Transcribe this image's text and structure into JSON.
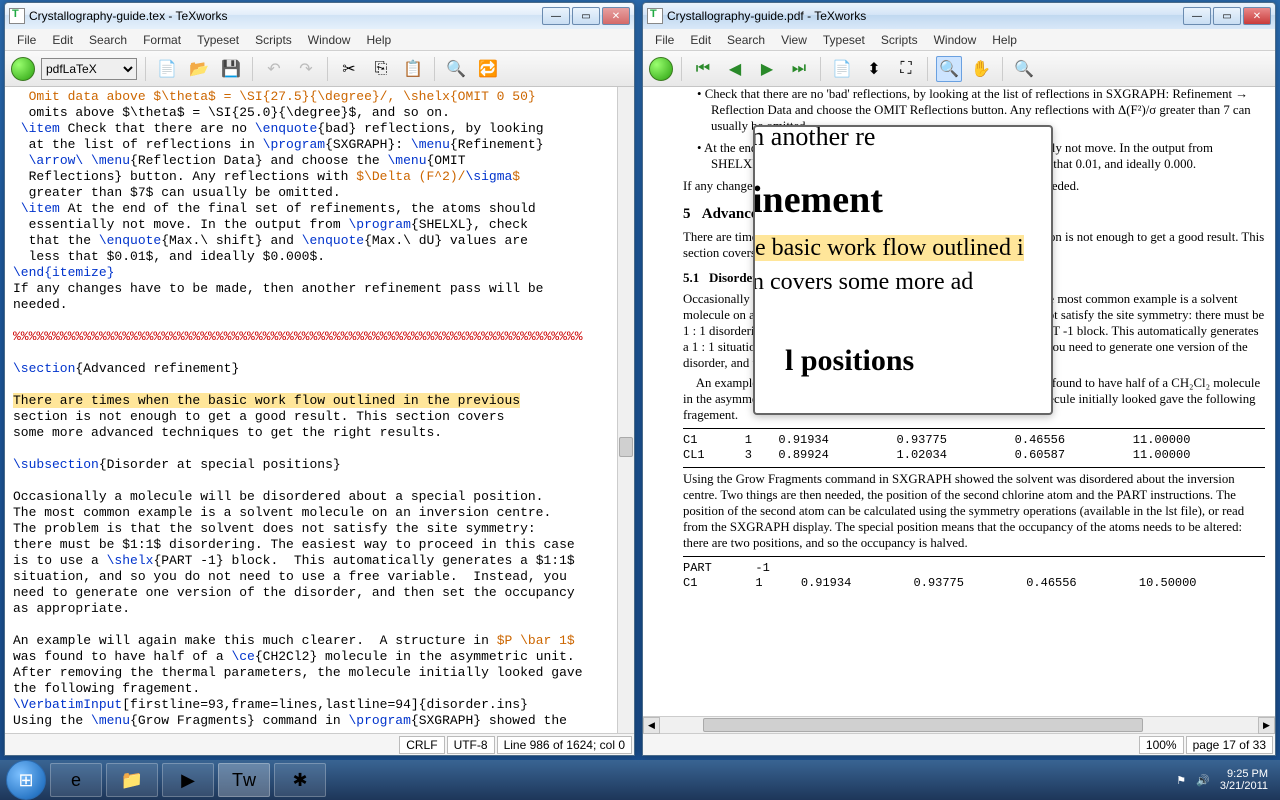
{
  "left_window": {
    "title": "Crystallography-guide.tex - TeXworks",
    "menu": [
      "File",
      "Edit",
      "Search",
      "Format",
      "Typeset",
      "Scripts",
      "Window",
      "Help"
    ],
    "engine": "pdfLaTeX",
    "status": {
      "crlf": "CRLF",
      "encoding": "UTF-8",
      "pos": "Line 986 of 1624; col 0"
    }
  },
  "right_window": {
    "title": "Crystallography-guide.pdf - TeXworks",
    "menu": [
      "File",
      "Edit",
      "Search",
      "View",
      "Typeset",
      "Scripts",
      "Window",
      "Help"
    ],
    "zoom": "100%",
    "page": "page 17 of 33",
    "content": {
      "bullet2_pre": "Check that there are no 'bad' reflections, by looking at the list of reflections in SXGRAPH: Refinement → Reflection Data and choose the OMIT Reflections button. Any reflections with Δ(F²)/σ greater than 7 can usually be omitted.",
      "bullet3": "At the end of the final set of refinements, the atoms should essentially not move. In the output from SHELXL, check that the 'Max. shift' and 'Max. dU' values are less that 0.01, and ideally 0.000.",
      "ifchanges": "If any changes have to be made, then another refinement pass will be needed.",
      "sec5_num": "5",
      "sec5_title": "Advanced refinement",
      "sec5_para": "There are times when the basic work flow outlined in the previous section is not enough to get a good result. This section covers some more advanced techniques to get the right results.",
      "sec51_num": "5.1",
      "sec51_title": "Disorder at special positions",
      "sec51_p1": "Occasionally a molecule will be disordered about a special position. The most common example is a solvent molecule on an inversion centre. The problem is that the solvent does not satisfy the site symmetry: there must be 1 : 1 disordering. The easiest way to proceed in this case is to use a PART -1 block. This automatically generates a 1 : 1 situation, and so you do not need to use a free variable. Instead, you need to generate one version of the disorder, and then set the occupancy as appropriate.",
      "sec51_p2": "    An example will again make this much clearer. A structure in P1̄ was found to have half of a CH₂Cl₂ molecule in the asymmetric unit. After removing the thermal parameters, the molecule initially looked gave the following fragement.",
      "table1": [
        [
          "C1",
          "1",
          "0.91934",
          "0.93775",
          "0.46556",
          "11.00000"
        ],
        [
          "CL1",
          "3",
          "0.89924",
          "1.02034",
          "0.60587",
          "11.00000"
        ]
      ],
      "sec51_p3": "Using the Grow Fragments command in SXGRAPH showed the solvent was disordered about the inversion centre. Two things are then needed, the position of the second chlorine atom and the PART instructions. The position of the second atom can be calculated using the symmetry operations (available in the lst file), or read from the SXGRAPH display. The special position means that the occupancy of the atoms needs to be altered: there are two positions, and so the occupancy is halved.",
      "table2": [
        [
          "PART",
          "-1",
          "",
          "",
          "",
          ""
        ],
        [
          "C1",
          "1",
          "0.91934",
          "0.93775",
          "0.46556",
          "10.50000"
        ]
      ]
    },
    "magnifier": {
      "line1": "e, then another re",
      "line2": "inement",
      "line3": "he basic work flow outlined i",
      "line4": "on covers some more ad",
      "line5": "l positions"
    }
  },
  "latex_source": {
    "l0": "  Omit data above $\\theta$ = \\SI{27.5}{\\degree}/, \\shelx{OMIT 0 50}",
    "l1": "  omits above $\\theta$ = \\SI{25.0}{\\degree}$, and so on.",
    "l2a": " \\item",
    "l2b": " Check that there are no ",
    "l2c": "\\enquote",
    "l2d": "{bad}",
    "l2e": " reflections, by looking",
    "l3a": "  at the list of reflections in ",
    "l3b": "\\program",
    "l3c": "{SXGRAPH}: ",
    "l3d": "\\menu",
    "l3e": "{Refinement}",
    "l4a": "  ",
    "l4b": "\\arrow\\ \\menu",
    "l4c": "{Reflection Data} and choose the ",
    "l4d": "\\menu",
    "l4e": "{OMIT",
    "l5a": "  Reflections} button. Any reflections with ",
    "l5b": "$\\Delta (F^2)/",
    "l5c": "\\sigma",
    "l5d": "$",
    "l6": "  greater than $7$ can usually be omitted.",
    "l7a": " \\item",
    "l7b": " At the end of the final set of refinements, the atoms should",
    "l8a": "  essentially not move. In the output from ",
    "l8b": "\\program",
    "l8c": "{SHELXL}, check",
    "l9a": "  that the ",
    "l9b": "\\enquote",
    "l9c": "{Max.\\ shift} and ",
    "l9d": "\\enquote",
    "l9e": "{Max.\\ dU} values are",
    "l10": "  less that $0.01$, and ideally $0.000$.",
    "l11": "\\end{itemize}",
    "l12": "If any changes have to be made, then another refinement pass will be",
    "l13": "needed.",
    "l14": "%%%%%%%%%%%%%%%%%%%%%%%%%%%%%%%%%%%%%%%%%%%%%%%%%%%%%%%%%%%%%%%%%%%%%%%%%",
    "l15a": "\\section",
    "l15b": "{Advanced refinement}",
    "l16": "There are times when the basic work flow outlined in the previous",
    "l17": "section is not enough to get a good result. This section covers",
    "l18": "some more advanced techniques to get the right results.",
    "l19a": "\\subsection",
    "l19b": "{Disorder at special positions}",
    "l20": "Occasionally a molecule will be disordered about a special position.",
    "l21": "The most common example is a solvent molecule on an inversion centre.",
    "l22": "The problem is that the solvent does not satisfy the site symmetry:",
    "l23": "there must be $1:1$ disordering. The easiest way to proceed in this case",
    "l24a": "is to use a ",
    "l24b": "\\shelx",
    "l24c": "{PART -1} block.  This automatically generates a $1:1$",
    "l25": "situation, and so you do not need to use a free variable.  Instead, you",
    "l26": "need to generate one version of the disorder, and then set the occupancy",
    "l27": "as appropriate.",
    "l28a": "An example will again make this much clearer.  A structure in ",
    "l28b": "$P \\bar 1$",
    "l29a": "was found to have half of a ",
    "l29b": "\\ce",
    "l29c": "{CH2Cl2} molecule in the asymmetric unit.",
    "l30": "After removing the thermal parameters, the molecule initially looked gave",
    "l31": "the following fragement.",
    "l32a": "\\VerbatimInput",
    "l32b": "[firstline=93,frame=lines,lastline=94]{disorder.ins}",
    "l33a": "Using the ",
    "l33b": "\\menu",
    "l33c": "{Grow Fragments} command in ",
    "l33d": "\\program",
    "l33e": "{SXGRAPH} showed the"
  },
  "taskbar": {
    "time": "9:25 PM",
    "date": "3/21/2011"
  }
}
